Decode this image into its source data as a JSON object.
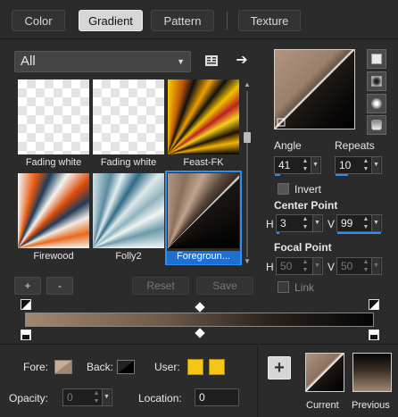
{
  "tabs": [
    {
      "label": "Color",
      "active": false
    },
    {
      "label": "Gradient",
      "active": true
    },
    {
      "label": "Pattern",
      "active": false
    },
    {
      "label": "Texture",
      "active": false
    }
  ],
  "library": {
    "category": "All",
    "add_label": "+",
    "remove_label": "-",
    "reset_label": "Reset",
    "save_label": "Save"
  },
  "gallery": [
    {
      "name": "Fading white",
      "selected": false
    },
    {
      "name": "Fading white",
      "selected": false
    },
    {
      "name": "Feast-FK",
      "selected": false
    },
    {
      "name": "Firewood",
      "selected": false
    },
    {
      "name": "Folly2",
      "selected": false
    },
    {
      "name": "Foregroun...",
      "selected": true
    }
  ],
  "settings": {
    "angle_label": "Angle",
    "angle_value": "41",
    "repeats_label": "Repeats",
    "repeats_value": "10",
    "invert_label": "Invert",
    "center_point_label": "Center Point",
    "h_label": "H",
    "v_label": "V",
    "center_h": "3",
    "center_v": "99",
    "focal_point_label": "Focal Point",
    "focal_h": "50",
    "focal_v": "50",
    "link_label": "Link"
  },
  "bottom": {
    "fore_label": "Fore:",
    "back_label": "Back:",
    "user_label": "User:",
    "opacity_label": "Opacity:",
    "opacity_value": "0",
    "location_label": "Location:",
    "location_value": "0",
    "add_label": "+",
    "current_label": "Current",
    "previous_label": "Previous"
  },
  "colors": {
    "accent": "#2d8ff0",
    "foreground": "#a38770",
    "background": "#050505",
    "user_1": "#f5c518",
    "user_2": "#f5c518"
  }
}
